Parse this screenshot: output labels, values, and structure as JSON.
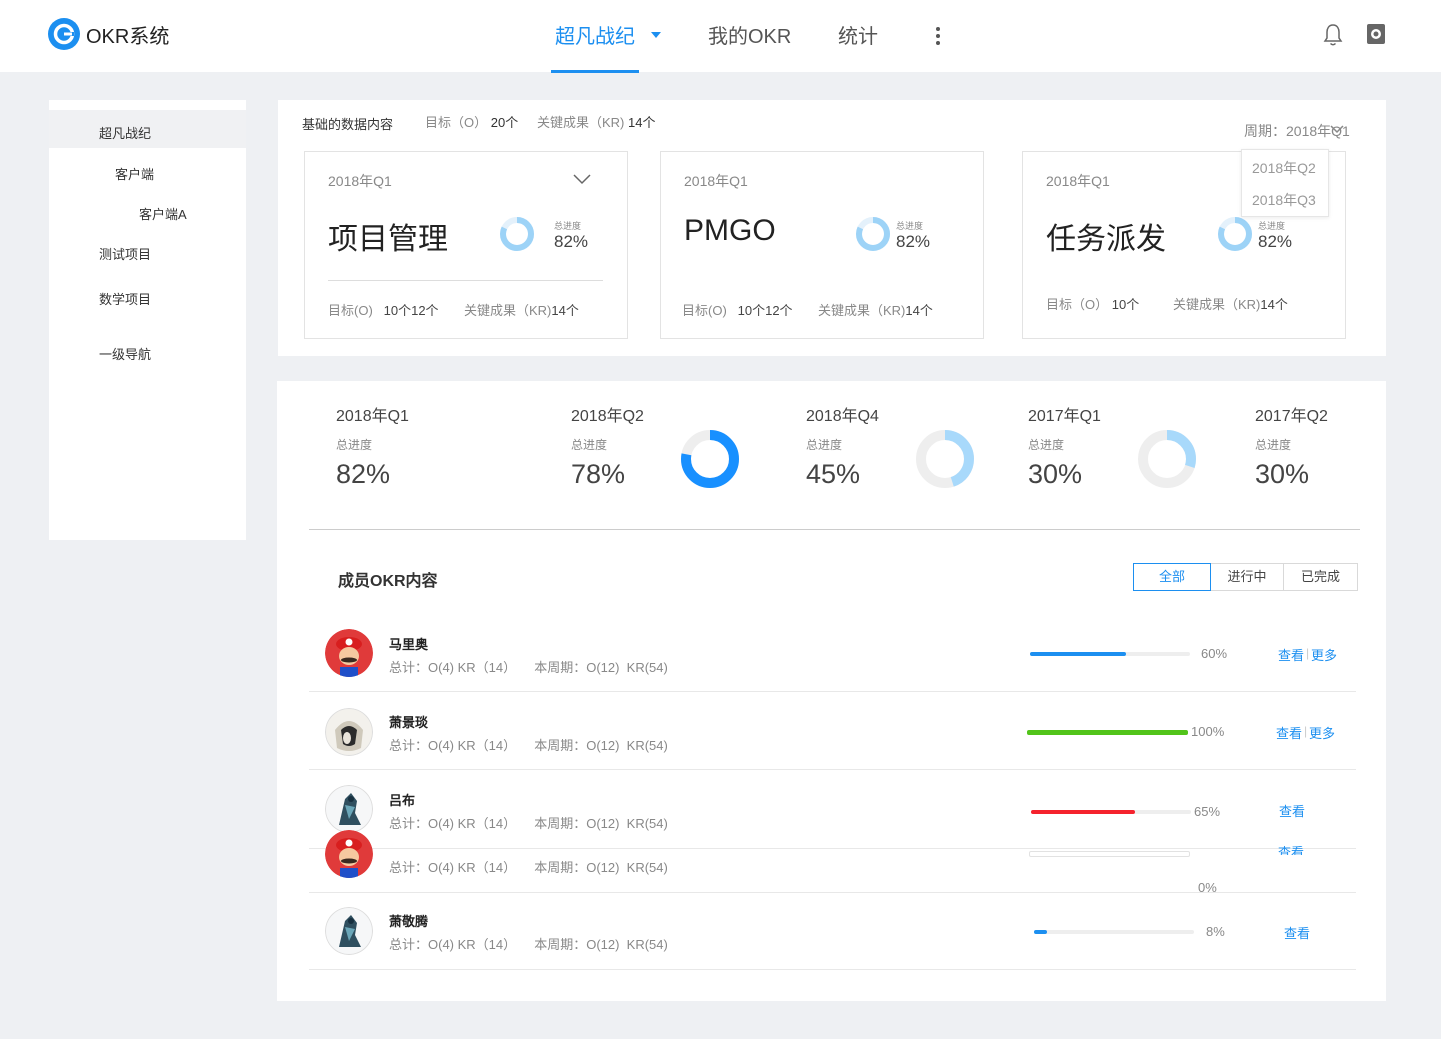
{
  "app": {
    "title": "OKR系统",
    "logo_icon": "okr-logo-icon"
  },
  "nav": {
    "items": [
      "超凡战纪",
      "我的OKR",
      "统计"
    ],
    "active_index": 0,
    "accent": "#1c8ff0"
  },
  "sidebar": {
    "items": [
      {
        "label": "超凡战纪",
        "level": 1,
        "selected": true
      },
      {
        "label": "客户端",
        "level": 2
      },
      {
        "label": "客户端A",
        "level": 3
      },
      {
        "label": "测试项目",
        "level": 1
      },
      {
        "label": "数学项目",
        "level": 1
      },
      {
        "label": "一级导航",
        "level": 1
      }
    ]
  },
  "summary": {
    "title": "基础的数据内容",
    "objectives": {
      "label": "目标（O）",
      "value": "20个"
    },
    "key_results": {
      "label": "关键成果（KR)",
      "value": "14个"
    },
    "period_label": "周期：2018年Q1",
    "period_options": [
      "2018年Q2",
      "2018年Q3"
    ],
    "progress_label": "总进度",
    "cards": [
      {
        "period": "2018年Q1",
        "name": "项目管理",
        "progress": "82%",
        "progress_value": 82,
        "obj_label": "目标(O)",
        "obj_value": "10个12个",
        "kr_label": "关键成果（KR)",
        "kr_value": "14个"
      },
      {
        "period": "2018年Q1",
        "name": "PMGO",
        "progress": "82%",
        "progress_value": 82,
        "obj_label": "目标(O)",
        "obj_value": "10个12个",
        "kr_label": "关键成果（KR)",
        "kr_value": "14个"
      },
      {
        "period": "2018年Q1",
        "name": "任务派发",
        "progress": "82%",
        "progress_value": 82,
        "obj_label": "目标（O）",
        "obj_value": "10个",
        "kr_label": "关键成果（KR)",
        "kr_value": "14个"
      }
    ]
  },
  "quarters": {
    "progress_label": "总进度",
    "items": [
      {
        "period": "2018年Q1",
        "value": "82%",
        "progress": 82,
        "ring": false
      },
      {
        "period": "2018年Q2",
        "value": "78%",
        "progress": 78,
        "ring": true
      },
      {
        "period": "2018年Q4",
        "value": "45%",
        "progress": 45,
        "ring": true
      },
      {
        "period": "2017年Q1",
        "value": "30%",
        "progress": 30,
        "ring": true
      },
      {
        "period": "2017年Q2",
        "value": "30%",
        "progress": 30,
        "ring": false
      }
    ]
  },
  "members": {
    "title": "成员OKR内容",
    "filters": [
      "全部",
      "进行中",
      "已完成"
    ],
    "active_filter": 0,
    "view_label": "查看",
    "more_label": "更多",
    "rows": [
      {
        "name": "马里奥",
        "total": "总计：O(4) KR（14）",
        "period": "本周期：O(12)  KR(54)",
        "pct": "60%",
        "progress": 60,
        "color": "#1c8ff0",
        "avatar": "mario-avatar",
        "more": true
      },
      {
        "name": "萧景琰",
        "total": "总计：O(4) KR（14）",
        "period": "本周期：O(12)  KR(54)",
        "pct": "100%",
        "progress": 100,
        "color": "#52c41a",
        "avatar": "warrior-avatar",
        "more": true
      },
      {
        "name": "吕布",
        "total": "总计：O(4) KR（14）",
        "period": "本周期：O(12)  KR(54)",
        "pct": "65%",
        "progress": 65,
        "color": "#f5222d",
        "avatar": "knight-avatar",
        "more": false
      },
      {
        "name": "",
        "total": "总计：O(4) KR（14）",
        "period": "本周期：O(12)  KR(54)",
        "pct": "0%",
        "progress": 0,
        "color": "#1c8ff0",
        "avatar": "mario-avatar",
        "more": false
      },
      {
        "name": "萧敬腾",
        "total": "总计：O(4) KR（14）",
        "period": "本周期：O(12)  KR(54)",
        "pct": "8%",
        "progress": 8,
        "color": "#1c8ff0",
        "avatar": "knight-avatar",
        "more": false
      }
    ]
  }
}
